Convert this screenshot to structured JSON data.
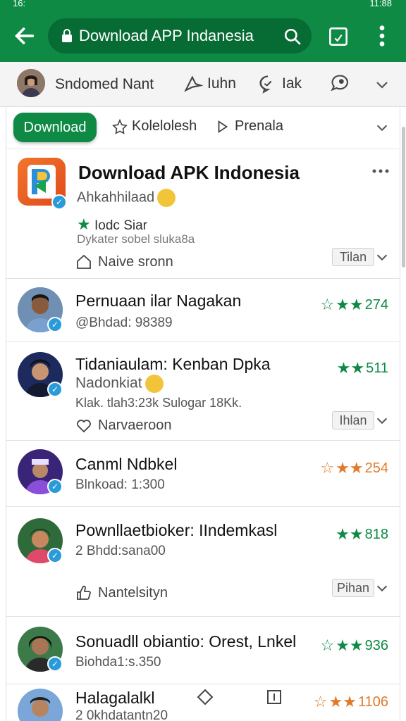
{
  "status": {
    "left": "16:",
    "right": "11:88"
  },
  "browser": {
    "url_text": "Download APP Indanesia"
  },
  "channel": {
    "name": "Sndomed Nant",
    "actions": [
      {
        "label": "Iuhn"
      },
      {
        "label": "Iak"
      }
    ]
  },
  "filters": {
    "active": "Download",
    "items": [
      "Kolelolesh",
      "Prenala"
    ]
  },
  "featured": {
    "title": "Download APK Indonesia",
    "subtitle": "Ahkahhilaad",
    "badge": "Iodc Siar",
    "meta": "Dykater sobel sluka8a",
    "action": "Naive sronn",
    "chip": "Tilan"
  },
  "items": [
    {
      "title": "Pernuaan ilar Nagakan",
      "sub": "@Bhdad: 98389",
      "rating": "274",
      "rating_color": "#0e8a45"
    },
    {
      "title": "Tidaniaulam: Kenban Dpka",
      "sub_green": "Nadonkiat",
      "sub": "Klak. tlah3:23k Sulogar 18Kk.",
      "rating": "511",
      "rating_color": "#0e8a45",
      "action": "Narvaeroon",
      "chip": "Ihlan"
    },
    {
      "title": "Canml Ndbkel",
      "sub": "Blnkoad: 1:300",
      "rating": "254",
      "rating_color": "#e07a2a"
    },
    {
      "title": "Pownllaetbioker: IIndemkasl",
      "sub": "2 Bhdd:sana00",
      "rating": "818",
      "rating_color": "#0e8a45",
      "action": "Nantelsityn",
      "chip": "Pihan"
    },
    {
      "title": "Sonuadll obiantio: Orest, Lnkel",
      "sub": "Biohda1:s.350",
      "rating": "936",
      "rating_color": "#0e8a45"
    },
    {
      "title": "Halagalalkl",
      "sub": "2 0khdatantn20",
      "rating": "1106",
      "rating_color": "#e07a2a"
    }
  ]
}
